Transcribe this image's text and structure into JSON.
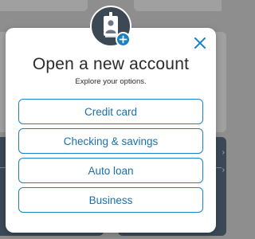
{
  "modal": {
    "title": "Open a new account",
    "subtitle": "Explore your options.",
    "options": [
      {
        "label": "Credit card"
      },
      {
        "label": "Checking & savings"
      },
      {
        "label": "Auto loan"
      },
      {
        "label": "Business"
      }
    ]
  },
  "icons": {
    "avatar": "id-badge-icon",
    "plus": "plus-icon",
    "close": "close-icon"
  },
  "colors": {
    "accent": "#1a82c4",
    "accent_text": "#1a6fae",
    "overlay": "#8e8e8e",
    "avatar_bg": "#3c4853",
    "panel_bg": "#3b4957"
  }
}
